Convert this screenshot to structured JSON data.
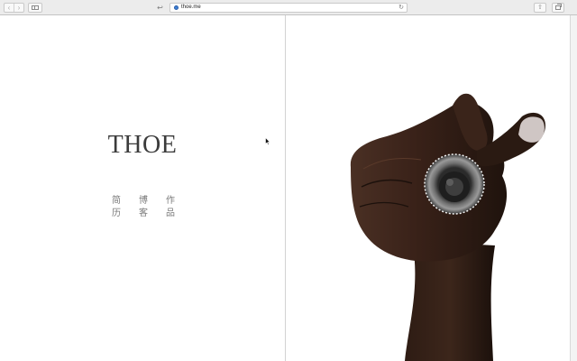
{
  "browser": {
    "url": "thoe.me",
    "icons": {
      "back": "chevron-left-icon",
      "forward": "chevron-right-icon",
      "sidebar": "sidebar-icon",
      "reader": "reader-icon",
      "site": "globe-icon",
      "reload": "reload-icon",
      "share": "share-icon",
      "tabs": "tabs-icon"
    }
  },
  "site": {
    "logo": "THOE",
    "nav_rows": [
      [
        "简",
        "博",
        "作"
      ],
      [
        "历",
        "客",
        "品"
      ]
    ]
  },
  "colors": {
    "toolbar_bg": "#ececec",
    "logo": "#3b3b3b",
    "nav_text": "#7a7a7a",
    "skin_dark": "#2a1a12",
    "ring": "#555555"
  }
}
